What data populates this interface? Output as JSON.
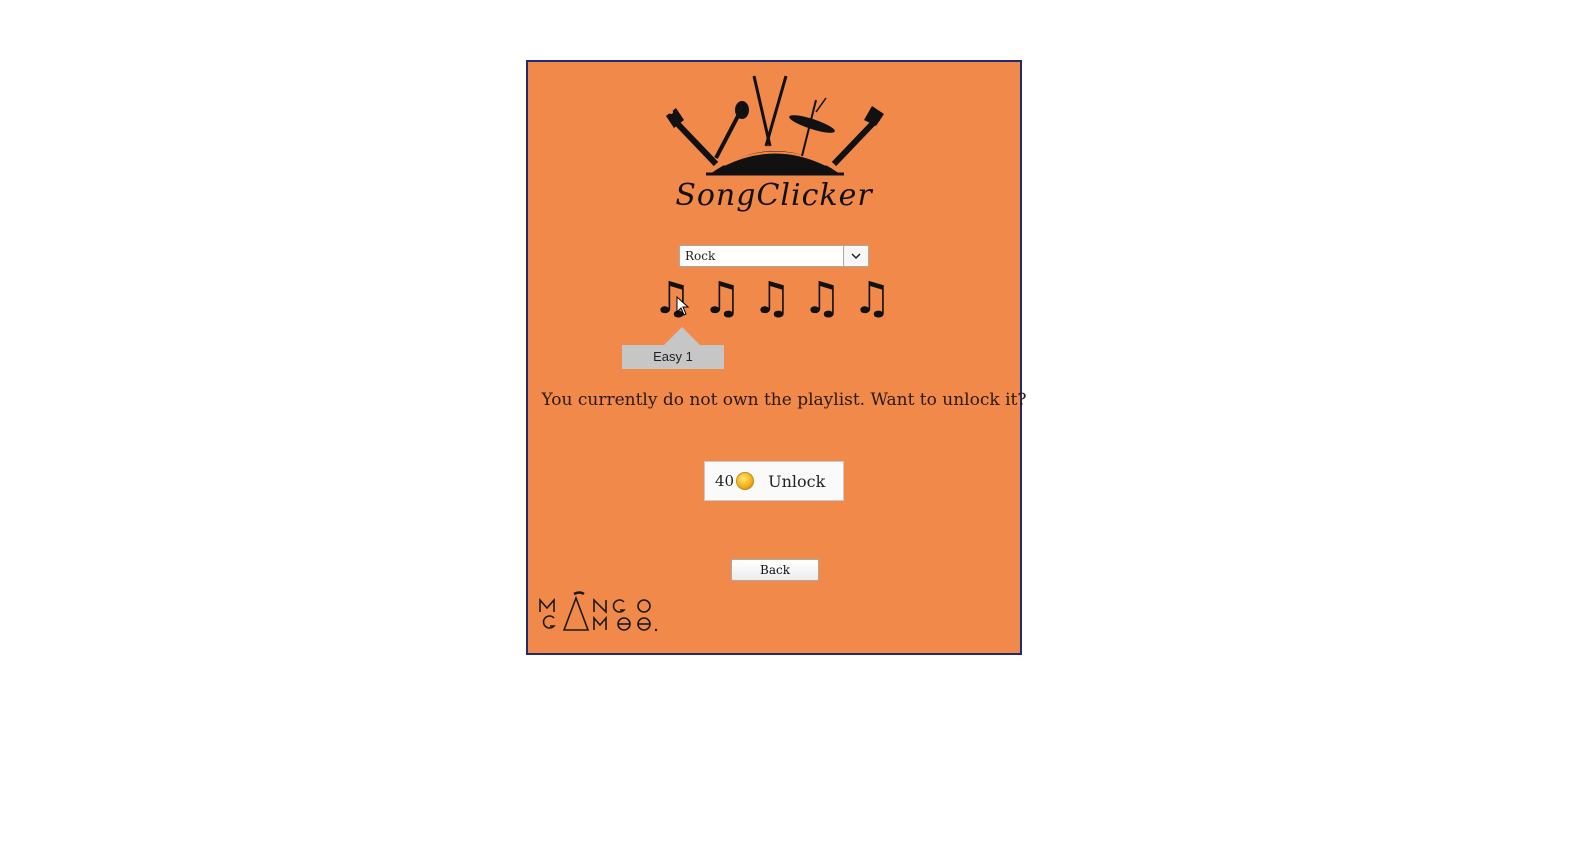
{
  "app": {
    "title": "SongClicker"
  },
  "genre_select": {
    "selected": "Rock"
  },
  "difficulty_notes": {
    "count": 5,
    "icon": "music-note-icon",
    "hovered_index": 0
  },
  "tooltip": {
    "text": "Easy 1"
  },
  "message": {
    "text": "You currently do not own the playlist. Want to unlock it?"
  },
  "unlock": {
    "price": "40",
    "label": "Unlock",
    "currency_icon": "coin-icon"
  },
  "back": {
    "label": "Back"
  },
  "colors": {
    "background": "#f0894a",
    "border": "#1f2b6e",
    "tooltip": "#c6c6c6"
  }
}
